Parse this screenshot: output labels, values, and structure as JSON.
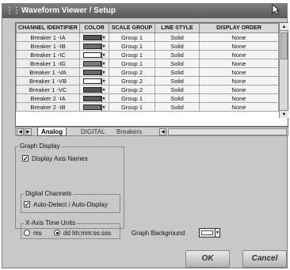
{
  "window": {
    "title": "Waveform Viewer / Setup"
  },
  "grid": {
    "columns": [
      "CHANNEL IDENTIFIER",
      "COLOR",
      "SCALE GROUP",
      "LINE STYLE",
      "DISPLAY ORDER"
    ],
    "rows": [
      {
        "identifier": "Breaker 1 -IA",
        "color": "#555555",
        "scale_group": "Group 1",
        "line_style": "Solid",
        "display_order": "None"
      },
      {
        "identifier": "Breaker 1 -IB",
        "color": "#6e6e6e",
        "scale_group": "Group 1",
        "line_style": "Solid",
        "display_order": "None"
      },
      {
        "identifier": "Breaker 1 -IC",
        "color": "#ffffff",
        "scale_group": "Group 1",
        "line_style": "Solid",
        "display_order": "None"
      },
      {
        "identifier": "Breaker 1 -IG",
        "color": "#7a7a7a",
        "scale_group": "Group 1",
        "line_style": "Solid",
        "display_order": "None"
      },
      {
        "identifier": "Breaker 1 -VA",
        "color": "#666666",
        "scale_group": "Group 2",
        "line_style": "Solid",
        "display_order": "None"
      },
      {
        "identifier": "Breaker 1 -VB",
        "color": "#ffffff",
        "scale_group": "Group 2",
        "line_style": "Solid",
        "display_order": "None"
      },
      {
        "identifier": "Breaker 1 -VC",
        "color": "#555555",
        "scale_group": "Group 2",
        "line_style": "Solid",
        "display_order": "None"
      },
      {
        "identifier": "Breaker 2 -IA",
        "color": "#5a5a5a",
        "scale_group": "Group 1",
        "line_style": "Solid",
        "display_order": "None"
      },
      {
        "identifier": "Breaker 2 -IB",
        "color": "#707070",
        "scale_group": "Group 1",
        "line_style": "Solid",
        "display_order": "None"
      }
    ]
  },
  "tabs": [
    {
      "label": "Analog",
      "active": true
    },
    {
      "label": "DIGITAL",
      "active": false
    },
    {
      "label": "Breakers",
      "active": false
    }
  ],
  "graph_display": {
    "label": "Graph Display",
    "display_axis_names": {
      "label": "Display Axis Names",
      "checked": true
    }
  },
  "digital_channels": {
    "label": "Digital Channels",
    "auto_detect": {
      "label": "Auto-Detect / Auto-Display",
      "checked": true
    }
  },
  "x_axis_time_units": {
    "label": "X-Axis Time Units",
    "options": [
      {
        "label": "ms",
        "selected": false
      },
      {
        "label": "dd hh:mm:ss.sss",
        "selected": true
      }
    ]
  },
  "graph_background": {
    "label": "Graph Background",
    "color": "#ffffff"
  },
  "buttons": {
    "ok": "OK",
    "cancel": "Cancel"
  }
}
